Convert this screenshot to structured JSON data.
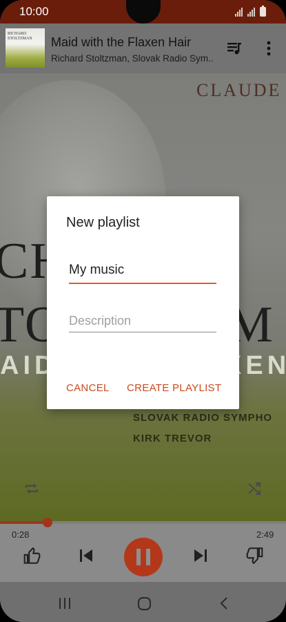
{
  "status_bar": {
    "time": "10:00"
  },
  "now_playing": {
    "title": "Maid with the Flaxen Hair",
    "artist": "Richard Stoltzman, Slovak Radio Sym..",
    "album_art_text": {
      "top": "CLAUDE",
      "line1": "CH",
      "line2": "TO",
      "line2_right": "M",
      "band": "AID",
      "band_right": "XEN",
      "orchestra": "SLOVAK RADIO SYMPHO",
      "conductor": "KIRK TREVOR"
    },
    "current_time": "0:28",
    "total_time": "2:49",
    "progress": 0.166
  },
  "dialog": {
    "title": "New playlist",
    "name_value": "My music",
    "description_placeholder": "Description",
    "cancel_label": "CANCEL",
    "create_label": "CREATE PLAYLIST"
  },
  "colors": {
    "accent": "#e25a2a",
    "button_text": "#c9491d",
    "status_bar": "#6a1d0a"
  },
  "icons": [
    "queue-music-icon",
    "more-vert-icon",
    "repeat-icon",
    "shuffle-icon",
    "thumb-up-icon",
    "skip-previous-icon",
    "pause-icon",
    "skip-next-icon",
    "thumb-down-icon",
    "recents-icon",
    "home-icon",
    "back-icon"
  ]
}
